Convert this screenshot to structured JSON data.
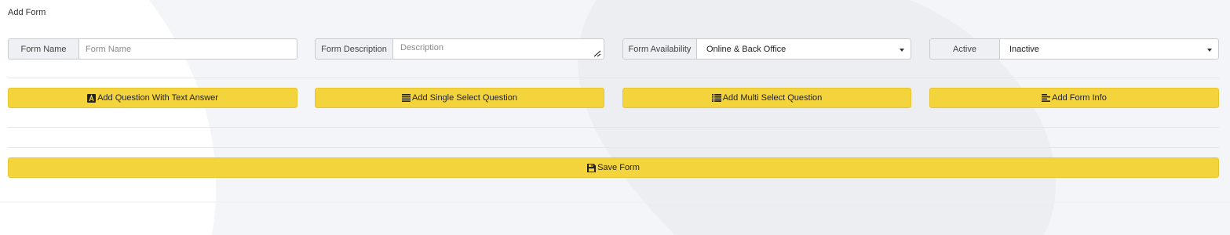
{
  "page": {
    "title": "Add Form"
  },
  "fields": {
    "form_name": {
      "label": "Form Name",
      "placeholder": "Form Name",
      "value": ""
    },
    "form_description": {
      "label": "Form Description",
      "placeholder": "Description",
      "value": ""
    },
    "form_availability": {
      "label": "Form Availability",
      "value": "Online & Back Office"
    },
    "active": {
      "label": "Active",
      "value": "Inactive"
    }
  },
  "buttons": {
    "add_text_question": {
      "label": "Add Question With Text Answer",
      "icon": "font-a-icon"
    },
    "add_single_select": {
      "label": "Add Single Select Question",
      "icon": "list-lines-icon"
    },
    "add_multi_select": {
      "label": "Add Multi Select Question",
      "icon": "bulleted-list-icon"
    },
    "add_form_info": {
      "label": "Add Form Info",
      "icon": "align-left-icon"
    },
    "save_form": {
      "label": "Save Form",
      "icon": "floppy-disk-icon"
    }
  },
  "colors": {
    "button_bg": "#f4d43c",
    "label_bg": "#eef0f3",
    "border": "#c8ccd2"
  }
}
